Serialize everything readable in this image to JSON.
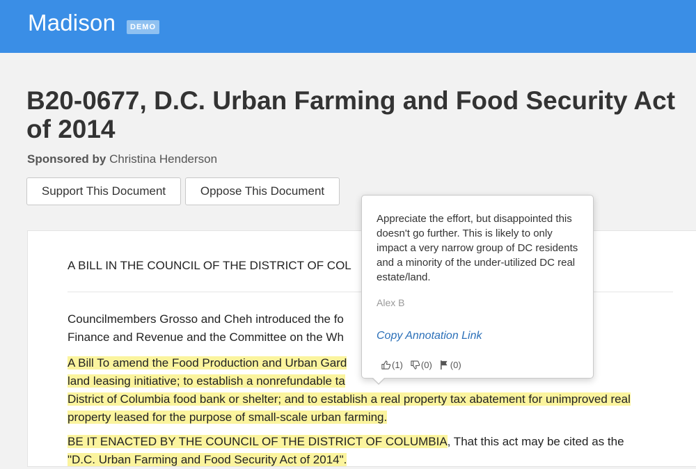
{
  "header": {
    "brand": "Madison",
    "badge": "DEMO",
    "color": "#3a8ee6"
  },
  "document": {
    "title": "B20-0677, D.C. Urban Farming and Food Security Act of 2014",
    "sponsor_label": "Sponsored by",
    "sponsor_name": "Christina Henderson",
    "support_button": "Support This Document",
    "oppose_button": "Oppose This Document",
    "heading": "A BILL IN THE COUNCIL OF THE DISTRICT OF COL",
    "p1": {
      "a": "Councilmembers Grosso and Cheh introduced the fo",
      "b": "Finance and Revenue and the Committee on the Wh"
    },
    "p2": {
      "a": "A Bill To amend the Food Production and Urban Gard",
      "b": "land leasing initiative; to establish a nonrefundable ta",
      "c": "District of Columbia food bank or shelter; and to establish a real property tax abatement for unimproved real",
      "d": "property leased for the purpose of small-scale urban farming."
    },
    "p3": {
      "a": "BE IT ENACTED BY THE COUNCIL OF THE DISTRICT OF COLUMBIA",
      "b": ", That this act may be cited as the",
      "c": "\"D.C. Urban Farming and Food Security Act of 2014\"."
    },
    "highlight_color": "#fbf49e"
  },
  "annotation": {
    "text": "Appreciate the effort, but disappointed this doesn't go further. This is likely to only impact a very narrow group of DC residents and a minority of the under-utilized DC real estate/land.",
    "author": "Alex B",
    "copy_link": "Copy Annotation Link",
    "likes": "(1)",
    "dislikes": "(0)",
    "flags": "(0)",
    "icons": [
      "thumbs-up-icon",
      "thumbs-down-icon",
      "flag-icon"
    ]
  }
}
